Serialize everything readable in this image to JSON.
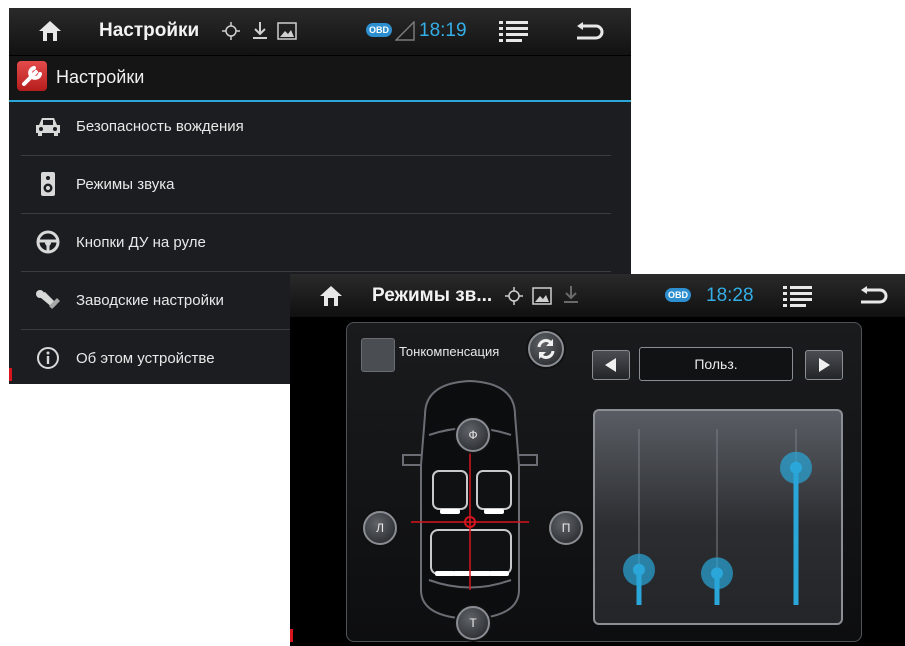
{
  "settings_window": {
    "status_bar": {
      "title": "Настройки",
      "time": "18:19",
      "obd": "OBD"
    },
    "app_title": "Настройки",
    "menu": [
      {
        "label": "Безопасность вождения",
        "icon": "car-icon"
      },
      {
        "label": "Режимы звука",
        "icon": "speaker-icon"
      },
      {
        "label": "Кнопки ДУ на руле",
        "icon": "steering-wheel-icon"
      },
      {
        "label": "Заводские настройки",
        "icon": "wrench-icon"
      },
      {
        "label": "Об этом устройстве",
        "icon": "info-icon"
      }
    ]
  },
  "sound_window": {
    "status_bar": {
      "title": "Режимы зв...",
      "time": "18:28",
      "obd": "OBD"
    },
    "loudness_label": "Тонкомпенсация",
    "loudness_checked": false,
    "preset": "Польз.",
    "balance": {
      "front": "Ф",
      "rear": "Т",
      "left": "Л",
      "right": "П"
    },
    "eq_levels": [
      0.2,
      0.18,
      0.78
    ],
    "accent_color": "#2aa6d9"
  }
}
